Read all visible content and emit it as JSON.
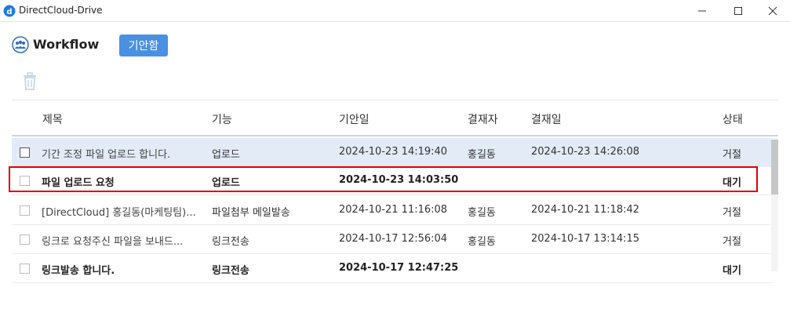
{
  "window": {
    "title": "DirectCloud-Drive",
    "icon": "cloud-d-icon",
    "controls": [
      "minimize-icon",
      "maximize-icon",
      "close-icon"
    ]
  },
  "header": {
    "icon": "people-group-icon",
    "title": "Workflow",
    "tab_label": "기안함",
    "accent": "#4a90e2"
  },
  "toolbar": {
    "delete_icon": "trash-icon"
  },
  "table": {
    "columns": [
      "제목",
      "기능",
      "기안일",
      "결재자",
      "결재일",
      "상태"
    ],
    "rows": [
      {
        "title": "기간 조정 파일 업로드 합니다.",
        "function": "업로드",
        "date": "2024-10-23 14:19:40",
        "approver": "홍길동",
        "approval_date": "2024-10-23 14:26:08",
        "status": "거절",
        "selected": true,
        "bold": false
      },
      {
        "title": "파일 업로드 요청",
        "function": "업로드",
        "date": "2024-10-23 14:03:50",
        "approver": "",
        "approval_date": "",
        "status": "대기",
        "selected": false,
        "bold": true
      },
      {
        "title": "[DirectCloud] 홍길동(마케팅팀)...",
        "function": "파일첨부 메일발송",
        "date": "2024-10-21 11:16:08",
        "approver": "홍길동",
        "approval_date": "2024-10-21 11:18:42",
        "status": "거절",
        "selected": false,
        "bold": false
      },
      {
        "title": "링크로 요청주신 파일을 보내드...",
        "function": "링크전송",
        "date": "2024-10-17 12:56:04",
        "approver": "홍길동",
        "approval_date": "2024-10-17 13:14:15",
        "status": "거절",
        "selected": false,
        "bold": false
      },
      {
        "title": "링크발송 합니다.",
        "function": "링크전송",
        "date": "2024-10-17 12:47:25",
        "approver": "",
        "approval_date": "",
        "status": "대기",
        "selected": false,
        "bold": true
      }
    ],
    "highlight_color": "#e00000"
  }
}
